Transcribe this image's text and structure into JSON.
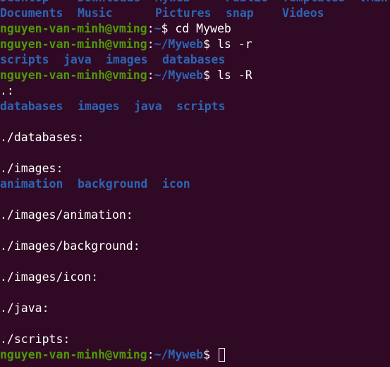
{
  "colors": {
    "background": "#300a24",
    "directory": "#2d64b5",
    "user_host": "#4e9a06",
    "text": "#ffffff"
  },
  "prompt": {
    "user_host": "nguyen-van-minh@vming",
    "separator": ":",
    "home_path": "~",
    "myweb_path": "~/Myweb",
    "symbol": "$ "
  },
  "home_listing": {
    "row1": [
      "Desktop",
      "Downloads",
      "Myweb",
      "Public",
      "Templates",
      "VMin"
    ],
    "row2": [
      "Documents",
      "Music",
      "Pictures",
      "snap",
      "Videos"
    ]
  },
  "commands": {
    "cd": "cd Myweb",
    "ls_r": "ls -r",
    "ls_R": "ls -R"
  },
  "ls_r_output": [
    "scripts",
    "java",
    "images",
    "databases"
  ],
  "ls_R_output": {
    "root_header": ".:",
    "root_items": [
      "databases",
      "images",
      "java",
      "scripts"
    ],
    "databases_header": "./databases:",
    "images_header": "./images:",
    "images_items": [
      "animation",
      "background",
      "icon"
    ],
    "animation_header": "./images/animation:",
    "background_header": "./images/background:",
    "icon_header": "./images/icon:",
    "java_header": "./java:",
    "scripts_header": "./scripts:"
  }
}
